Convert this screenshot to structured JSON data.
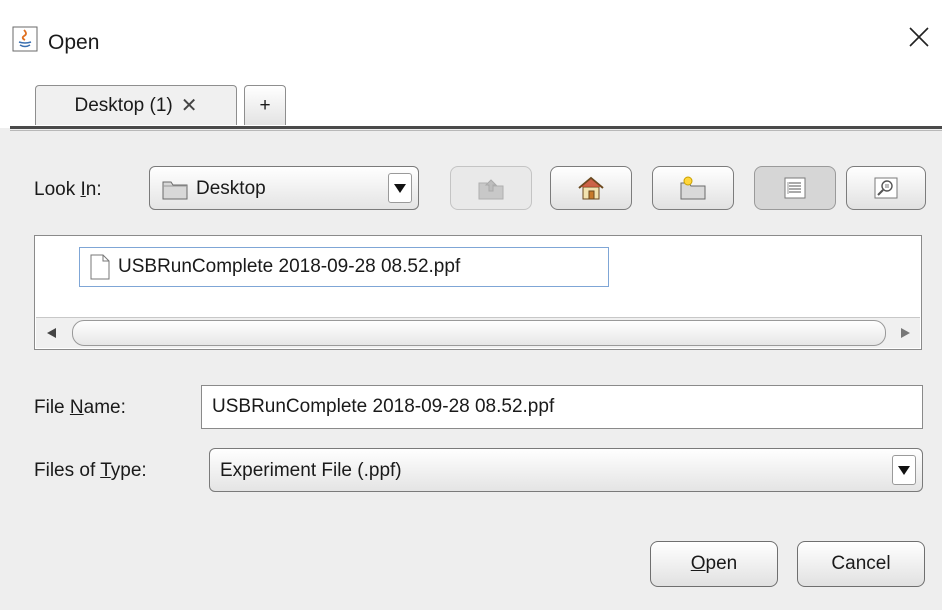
{
  "window": {
    "title": "Open",
    "app_icon": "java-icon",
    "close_glyph": "✕"
  },
  "tabs": [
    {
      "label": "Desktop (1)",
      "close_glyph": "✕"
    },
    {
      "label": "+"
    }
  ],
  "look_in": {
    "label_before": "Look ",
    "mnemonic": "I",
    "label_after": "n:",
    "value": "Desktop"
  },
  "toolbar": {
    "icons": [
      "up-folder-icon",
      "home-icon",
      "new-folder-icon",
      "list-view-icon",
      "details-view-icon"
    ],
    "disabled": [
      "up-folder-icon"
    ],
    "pressed": [
      "list-view-icon"
    ]
  },
  "files": [
    {
      "name": "USBRunComplete 2018-09-28 08.52.ppf",
      "selected": true
    }
  ],
  "file_name": {
    "label_before": "File ",
    "mnemonic": "N",
    "label_after": "ame:",
    "value": "USBRunComplete 2018-09-28 08.52.ppf"
  },
  "files_of_type": {
    "label_before": "Files of ",
    "mnemonic": "T",
    "label_after": "ype:",
    "value": "Experiment File (.ppf)"
  },
  "buttons": {
    "open_mnemonic": "O",
    "open_rest": "pen",
    "cancel": "Cancel"
  },
  "colors": {
    "selection_border": "#7fa6d6",
    "background": "#eeeeee"
  }
}
